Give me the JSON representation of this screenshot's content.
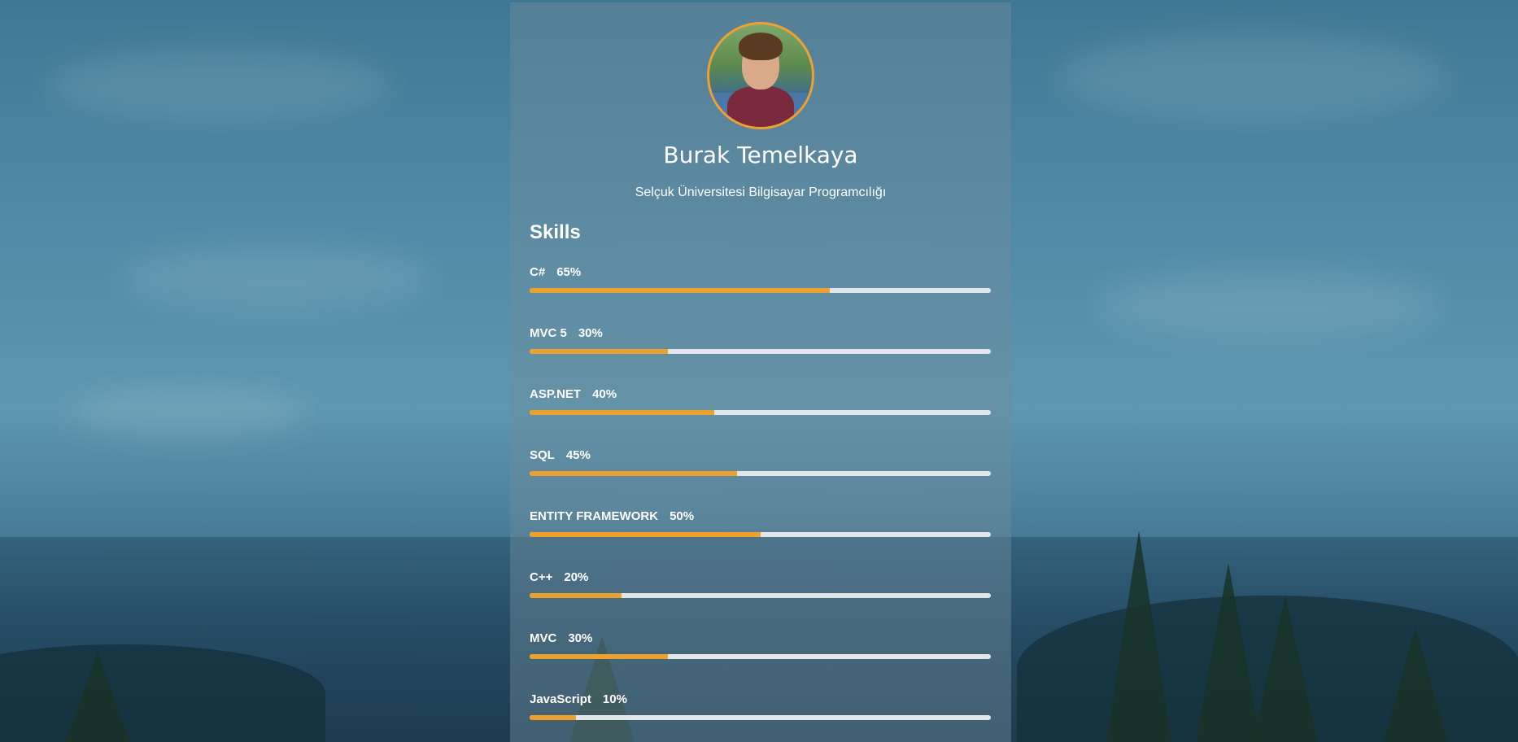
{
  "profile": {
    "name": "Burak Temelkaya",
    "subtitle": "Selçuk Üniversitesi Bilgisayar Programcılığı",
    "avatar_border_color": "#f0a030"
  },
  "skills": {
    "title": "Skills",
    "bar_color": "#eba02f",
    "track_color": "#e3e6e8",
    "items": [
      {
        "name": "C#",
        "percent_label": "65%",
        "value": 65
      },
      {
        "name": "MVC 5",
        "percent_label": "30%",
        "value": 30
      },
      {
        "name": "ASP.NET",
        "percent_label": "40%",
        "value": 40
      },
      {
        "name": "SQL",
        "percent_label": "45%",
        "value": 45
      },
      {
        "name": "ENTITY FRAMEWORK",
        "percent_label": "50%",
        "value": 50
      },
      {
        "name": "C++",
        "percent_label": "20%",
        "value": 20
      },
      {
        "name": "MVC",
        "percent_label": "30%",
        "value": 30
      },
      {
        "name": "JavaScript",
        "percent_label": "10%",
        "value": 10
      }
    ]
  }
}
